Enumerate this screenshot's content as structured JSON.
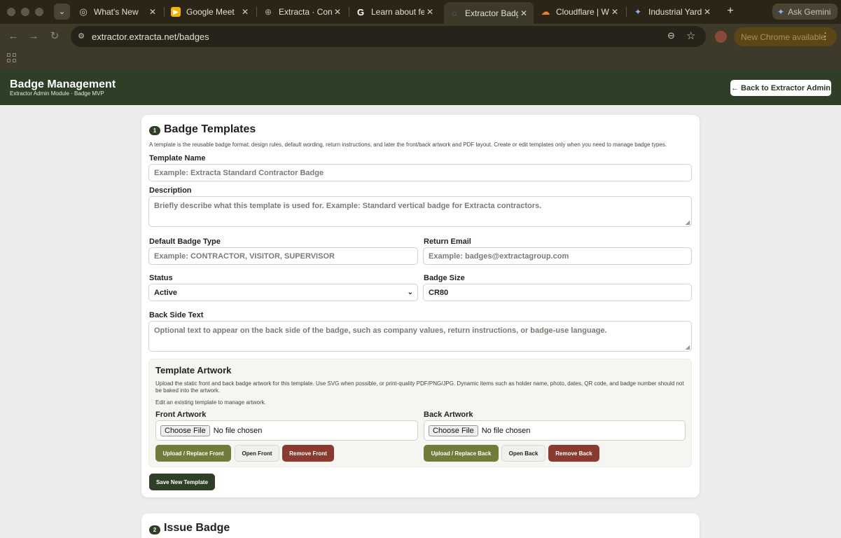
{
  "browser": {
    "tabs": [
      {
        "title": "What's New"
      },
      {
        "title": "Google Meet"
      },
      {
        "title": "Extracta · Conta"
      },
      {
        "title": "Learn about fea"
      },
      {
        "title": "Extractor Badge"
      },
      {
        "title": "Cloudflare | We"
      },
      {
        "title": "Industrial Yard"
      }
    ],
    "ask_gemini": "Ask Gemini",
    "url": "extractor.extracta.net/badges",
    "update_pill": "New Chrome available"
  },
  "header": {
    "title": "Badge Management",
    "subtitle": "Extractor Admin Module · Badge MVP",
    "back_button": "← Back to Extractor Admin",
    "bg_color": "#2f3f27"
  },
  "templates": {
    "step": "1",
    "title": "Badge Templates",
    "help": "A template is the reusable badge format: design rules, default wording, return instructions, and later the front/back artwork and PDF layout. Create or edit templates only when you need to manage badge types.",
    "template_name": {
      "label": "Template Name",
      "placeholder": "Example: Extracta Standard Contractor Badge"
    },
    "description": {
      "label": "Description",
      "placeholder": "Briefly describe what this template is used for. Example: Standard vertical badge for Extracta contractors."
    },
    "default_badge_type": {
      "label": "Default Badge Type",
      "placeholder": "Example: CONTRACTOR, VISITOR, SUPERVISOR"
    },
    "return_email": {
      "label": "Return Email",
      "placeholder": "Example: badges@extractagroup.com"
    },
    "status": {
      "label": "Status",
      "value": "Active"
    },
    "badge_size": {
      "label": "Badge Size",
      "value": "CR80"
    },
    "back_side_text": {
      "label": "Back Side Text",
      "placeholder": "Optional text to appear on the back side of the badge, such as company values, return instructions, or badge-use language."
    },
    "artwork": {
      "title": "Template Artwork",
      "help": "Upload the static front and back badge artwork for this template. Use SVG when possible, or print-quality PDF/PNG/JPG. Dynamic items such as holder name, photo, dates, QR code, and badge number should not be baked into the artwork.",
      "note": "Edit an existing template to manage artwork.",
      "front": {
        "label": "Front Artwork",
        "choose": "Choose File",
        "status": "No file chosen",
        "upload": "Upload / Replace Front",
        "open": "Open Front",
        "remove": "Remove Front"
      },
      "back": {
        "label": "Back Artwork",
        "choose": "Choose File",
        "status": "No file chosen",
        "upload": "Upload / Replace Back",
        "open": "Open Back",
        "remove": "Remove Back"
      }
    },
    "save_button": "Save New Template"
  },
  "issue": {
    "step": "2",
    "title": "Issue Badge"
  }
}
